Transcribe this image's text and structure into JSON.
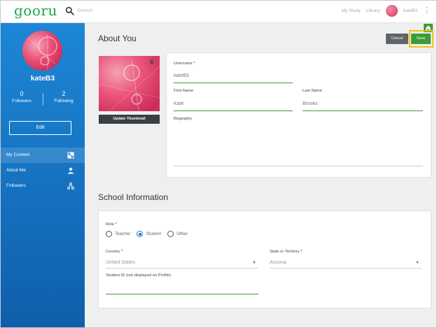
{
  "topbar": {
    "logo": "gooru",
    "search_placeholder": "Search",
    "nav": [
      "My Study",
      "Library"
    ],
    "user": "kateB3"
  },
  "sidebar": {
    "username": "kateB3",
    "followers_count": "0",
    "followers_label": "Followers",
    "following_count": "2",
    "following_label": "Following",
    "edit_label": "Edit",
    "menu": [
      {
        "label": "My Content",
        "icon": "content-icon",
        "active": true
      },
      {
        "label": "About Me",
        "icon": "person-icon",
        "active": false
      },
      {
        "label": "Followers",
        "icon": "network-icon",
        "active": false
      }
    ]
  },
  "about": {
    "title": "About You",
    "cancel_label": "Cancel",
    "save_label": "Save",
    "update_thumbnail_label": "Update Thumbnail",
    "username_label": "Username *",
    "username_value": "kateB3",
    "first_name_label": "First Name",
    "first_name_value": "Kate",
    "last_name_label": "Last Name",
    "last_name_value": "Brooks",
    "biography_label": "Biography",
    "biography_value": ""
  },
  "school": {
    "title": "School Information",
    "role_label": "Role *",
    "roles": [
      "Teacher",
      "Student",
      "Other"
    ],
    "selected_role": "Student",
    "country_label": "Country *",
    "country_value": "United States",
    "state_label": "State or Territory *",
    "state_value": "Arizona",
    "student_id_label": "Student ID (not displayed on Profile)",
    "student_id_value": ""
  },
  "colors": {
    "sidebar_blue": "#1673c2",
    "save_green": "#3f9b3a",
    "highlight_yellow": "#f0c419",
    "logo_green": "#1aa34a"
  }
}
